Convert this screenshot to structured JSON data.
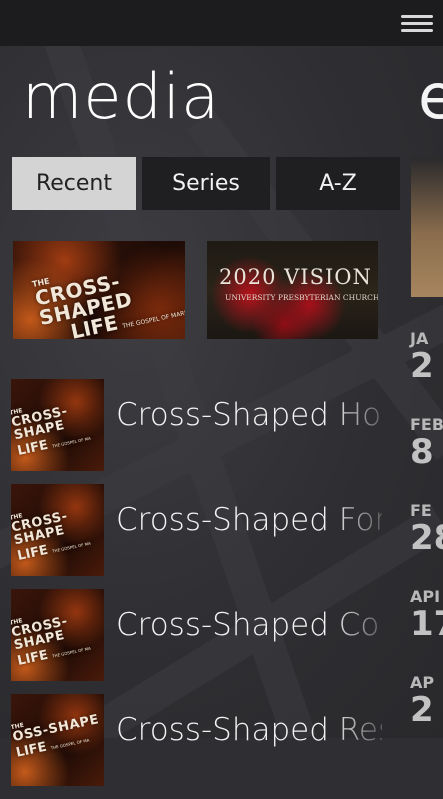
{
  "page": {
    "title": "media",
    "next_title": "e"
  },
  "tabs": [
    {
      "label": "Recent",
      "active": true
    },
    {
      "label": "Series",
      "active": false
    },
    {
      "label": "A-Z",
      "active": false
    }
  ],
  "featured": [
    {
      "the": "THE",
      "title_line1": "CROSS-SHAPED",
      "title_line2": "LIFE",
      "subtitle": "THE GOSPEL OF MARK"
    },
    {
      "the": "THE",
      "title": "2020 VISION",
      "subtitle": "UNIVERSITY PRESBYTERIAN CHURCH"
    }
  ],
  "list": [
    {
      "label": "Cross-Shaped Holi",
      "art": {
        "the": "THE",
        "line1": "CROSS-SHAPE",
        "line2": "LIFE",
        "sub": "THE GOSPEL OF MA"
      }
    },
    {
      "label": "Cross-Shaped Forg",
      "art": {
        "the": "THE",
        "line1": "CROSS-SHAPE",
        "line2": "LIFE",
        "sub": "THE GOSPEL OF MA"
      }
    },
    {
      "label": "Cross-Shaped Con",
      "art": {
        "the": "THE",
        "line1": "CROSS-SHAPE",
        "line2": "LIFE",
        "sub": "THE GOSPEL OF MA"
      }
    },
    {
      "label": "Cross-Shaped Rest",
      "art": {
        "the": "THE",
        "line1": "OSS-SHAPE",
        "line2": "LIFE",
        "sub": "THE GOSPEL OF MA"
      }
    }
  ],
  "side_dates": [
    {
      "month": "JA",
      "day": "2"
    },
    {
      "month": "FEB",
      "day": "8"
    },
    {
      "month": "FE",
      "day": "28"
    },
    {
      "month": "API",
      "day": "17"
    },
    {
      "month": "AP",
      "day": "2"
    }
  ],
  "icons": {
    "menu": "hamburger-menu-icon"
  },
  "colors": {
    "tab_active_bg": "#d4d4d4",
    "tab_bg": "#1f1f21",
    "topbar": "#1c1c1e"
  }
}
